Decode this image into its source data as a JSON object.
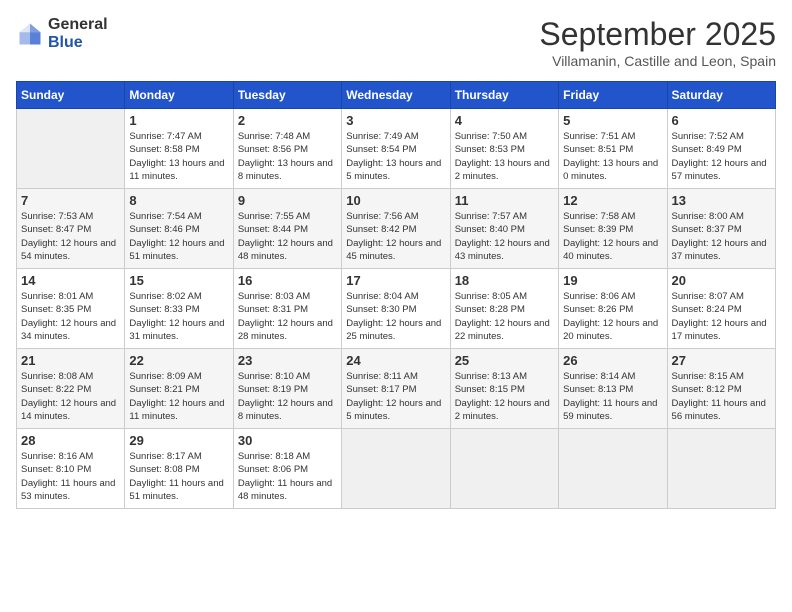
{
  "header": {
    "logo_general": "General",
    "logo_blue": "Blue",
    "month_title": "September 2025",
    "location": "Villamanin, Castille and Leon, Spain"
  },
  "weekdays": [
    "Sunday",
    "Monday",
    "Tuesday",
    "Wednesday",
    "Thursday",
    "Friday",
    "Saturday"
  ],
  "weeks": [
    [
      {
        "day": "",
        "empty": true
      },
      {
        "day": "1",
        "sunrise": "Sunrise: 7:47 AM",
        "sunset": "Sunset: 8:58 PM",
        "daylight": "Daylight: 13 hours and 11 minutes."
      },
      {
        "day": "2",
        "sunrise": "Sunrise: 7:48 AM",
        "sunset": "Sunset: 8:56 PM",
        "daylight": "Daylight: 13 hours and 8 minutes."
      },
      {
        "day": "3",
        "sunrise": "Sunrise: 7:49 AM",
        "sunset": "Sunset: 8:54 PM",
        "daylight": "Daylight: 13 hours and 5 minutes."
      },
      {
        "day": "4",
        "sunrise": "Sunrise: 7:50 AM",
        "sunset": "Sunset: 8:53 PM",
        "daylight": "Daylight: 13 hours and 2 minutes."
      },
      {
        "day": "5",
        "sunrise": "Sunrise: 7:51 AM",
        "sunset": "Sunset: 8:51 PM",
        "daylight": "Daylight: 13 hours and 0 minutes."
      },
      {
        "day": "6",
        "sunrise": "Sunrise: 7:52 AM",
        "sunset": "Sunset: 8:49 PM",
        "daylight": "Daylight: 12 hours and 57 minutes."
      }
    ],
    [
      {
        "day": "7",
        "sunrise": "Sunrise: 7:53 AM",
        "sunset": "Sunset: 8:47 PM",
        "daylight": "Daylight: 12 hours and 54 minutes."
      },
      {
        "day": "8",
        "sunrise": "Sunrise: 7:54 AM",
        "sunset": "Sunset: 8:46 PM",
        "daylight": "Daylight: 12 hours and 51 minutes."
      },
      {
        "day": "9",
        "sunrise": "Sunrise: 7:55 AM",
        "sunset": "Sunset: 8:44 PM",
        "daylight": "Daylight: 12 hours and 48 minutes."
      },
      {
        "day": "10",
        "sunrise": "Sunrise: 7:56 AM",
        "sunset": "Sunset: 8:42 PM",
        "daylight": "Daylight: 12 hours and 45 minutes."
      },
      {
        "day": "11",
        "sunrise": "Sunrise: 7:57 AM",
        "sunset": "Sunset: 8:40 PM",
        "daylight": "Daylight: 12 hours and 43 minutes."
      },
      {
        "day": "12",
        "sunrise": "Sunrise: 7:58 AM",
        "sunset": "Sunset: 8:39 PM",
        "daylight": "Daylight: 12 hours and 40 minutes."
      },
      {
        "day": "13",
        "sunrise": "Sunrise: 8:00 AM",
        "sunset": "Sunset: 8:37 PM",
        "daylight": "Daylight: 12 hours and 37 minutes."
      }
    ],
    [
      {
        "day": "14",
        "sunrise": "Sunrise: 8:01 AM",
        "sunset": "Sunset: 8:35 PM",
        "daylight": "Daylight: 12 hours and 34 minutes."
      },
      {
        "day": "15",
        "sunrise": "Sunrise: 8:02 AM",
        "sunset": "Sunset: 8:33 PM",
        "daylight": "Daylight: 12 hours and 31 minutes."
      },
      {
        "day": "16",
        "sunrise": "Sunrise: 8:03 AM",
        "sunset": "Sunset: 8:31 PM",
        "daylight": "Daylight: 12 hours and 28 minutes."
      },
      {
        "day": "17",
        "sunrise": "Sunrise: 8:04 AM",
        "sunset": "Sunset: 8:30 PM",
        "daylight": "Daylight: 12 hours and 25 minutes."
      },
      {
        "day": "18",
        "sunrise": "Sunrise: 8:05 AM",
        "sunset": "Sunset: 8:28 PM",
        "daylight": "Daylight: 12 hours and 22 minutes."
      },
      {
        "day": "19",
        "sunrise": "Sunrise: 8:06 AM",
        "sunset": "Sunset: 8:26 PM",
        "daylight": "Daylight: 12 hours and 20 minutes."
      },
      {
        "day": "20",
        "sunrise": "Sunrise: 8:07 AM",
        "sunset": "Sunset: 8:24 PM",
        "daylight": "Daylight: 12 hours and 17 minutes."
      }
    ],
    [
      {
        "day": "21",
        "sunrise": "Sunrise: 8:08 AM",
        "sunset": "Sunset: 8:22 PM",
        "daylight": "Daylight: 12 hours and 14 minutes."
      },
      {
        "day": "22",
        "sunrise": "Sunrise: 8:09 AM",
        "sunset": "Sunset: 8:21 PM",
        "daylight": "Daylight: 12 hours and 11 minutes."
      },
      {
        "day": "23",
        "sunrise": "Sunrise: 8:10 AM",
        "sunset": "Sunset: 8:19 PM",
        "daylight": "Daylight: 12 hours and 8 minutes."
      },
      {
        "day": "24",
        "sunrise": "Sunrise: 8:11 AM",
        "sunset": "Sunset: 8:17 PM",
        "daylight": "Daylight: 12 hours and 5 minutes."
      },
      {
        "day": "25",
        "sunrise": "Sunrise: 8:13 AM",
        "sunset": "Sunset: 8:15 PM",
        "daylight": "Daylight: 12 hours and 2 minutes."
      },
      {
        "day": "26",
        "sunrise": "Sunrise: 8:14 AM",
        "sunset": "Sunset: 8:13 PM",
        "daylight": "Daylight: 11 hours and 59 minutes."
      },
      {
        "day": "27",
        "sunrise": "Sunrise: 8:15 AM",
        "sunset": "Sunset: 8:12 PM",
        "daylight": "Daylight: 11 hours and 56 minutes."
      }
    ],
    [
      {
        "day": "28",
        "sunrise": "Sunrise: 8:16 AM",
        "sunset": "Sunset: 8:10 PM",
        "daylight": "Daylight: 11 hours and 53 minutes."
      },
      {
        "day": "29",
        "sunrise": "Sunrise: 8:17 AM",
        "sunset": "Sunset: 8:08 PM",
        "daylight": "Daylight: 11 hours and 51 minutes."
      },
      {
        "day": "30",
        "sunrise": "Sunrise: 8:18 AM",
        "sunset": "Sunset: 8:06 PM",
        "daylight": "Daylight: 11 hours and 48 minutes."
      },
      {
        "day": "",
        "empty": true
      },
      {
        "day": "",
        "empty": true
      },
      {
        "day": "",
        "empty": true
      },
      {
        "day": "",
        "empty": true
      }
    ]
  ]
}
